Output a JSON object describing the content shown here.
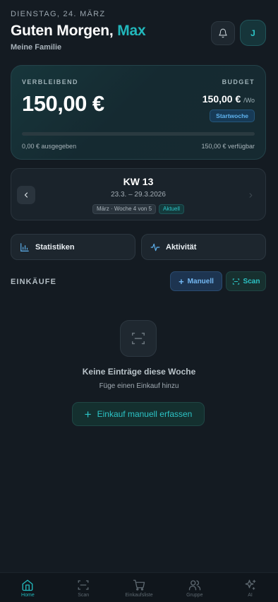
{
  "header": {
    "date": "DIENSTAG, 24. MÄRZ",
    "greeting": "Guten Morgen,",
    "user_name": "Max",
    "group": "Meine Familie",
    "avatar_initial": "J"
  },
  "budget_card": {
    "remaining_label": "VERBLEIBEND",
    "remaining_amount": "150,00 €",
    "budget_label": "BUDGET",
    "budget_amount": "150,00 €",
    "budget_period": "/Wo",
    "start_badge": "Startwoche",
    "spent_fraction": 0,
    "spent_text": "0,00 € ausgegeben",
    "available_text": "150,00 € verfügbar"
  },
  "week": {
    "title": "KW 13",
    "range": "23.3. – 29.3.2026",
    "month_tag": "März · Woche 4 von 5",
    "current_tag": "Aktuell"
  },
  "quick_actions": {
    "stats_label": "Statistiken",
    "activity_label": "Aktivität"
  },
  "purchases": {
    "section_title": "EINKÄUFE",
    "manual_label": "Manuell",
    "scan_label": "Scan",
    "empty_title": "Keine Einträge diese Woche",
    "empty_subtitle": "Füge einen Einkauf hinzu",
    "cta_label": "Einkauf manuell erfassen"
  },
  "tabbar": {
    "items": [
      {
        "label": "Home",
        "icon": "home-icon",
        "active": true
      },
      {
        "label": "Scan",
        "icon": "scan-icon",
        "active": false
      },
      {
        "label": "Einkaufsliste",
        "icon": "cart-icon",
        "active": false
      },
      {
        "label": "Gruppe",
        "icon": "users-icon",
        "active": false
      },
      {
        "label": "AI",
        "icon": "sparkles-icon",
        "active": false
      }
    ]
  },
  "colors": {
    "accent": "#22b8bc",
    "background": "#141b22",
    "blue": "#5fb3f0"
  }
}
